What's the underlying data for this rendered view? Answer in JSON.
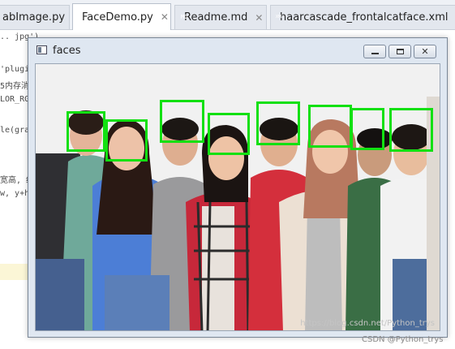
{
  "tabs": [
    {
      "label": "abImage.py",
      "icon": "python-file-icon",
      "active": false
    },
    {
      "label": "FaceDemo.py",
      "icon": "python-file-icon",
      "active": true
    },
    {
      "label": "Readme.md",
      "icon": "markdown-file-icon",
      "active": false
    },
    {
      "label": "haarcascade_frontalcatface.xml",
      "icon": "xml-file-icon",
      "active": false
    }
  ],
  "editor": {
    "lines": [
      ".. jpg')",
      "",
      "'plugi",
      "5内存消",
      "LOR_RGE",
      "",
      "le(gra",
      "",
      "",
      "宽高, 红",
      "w, y+h),"
    ]
  },
  "window": {
    "title": "faces",
    "watermark": "https://blog.csdn.net/Python_trys"
  },
  "footer": {
    "csdn_watermark": "CSDN @Python_trys"
  },
  "face_count": 8,
  "colors": {
    "detection_box": "#12e012",
    "window_frame": "#dfe7f1"
  }
}
